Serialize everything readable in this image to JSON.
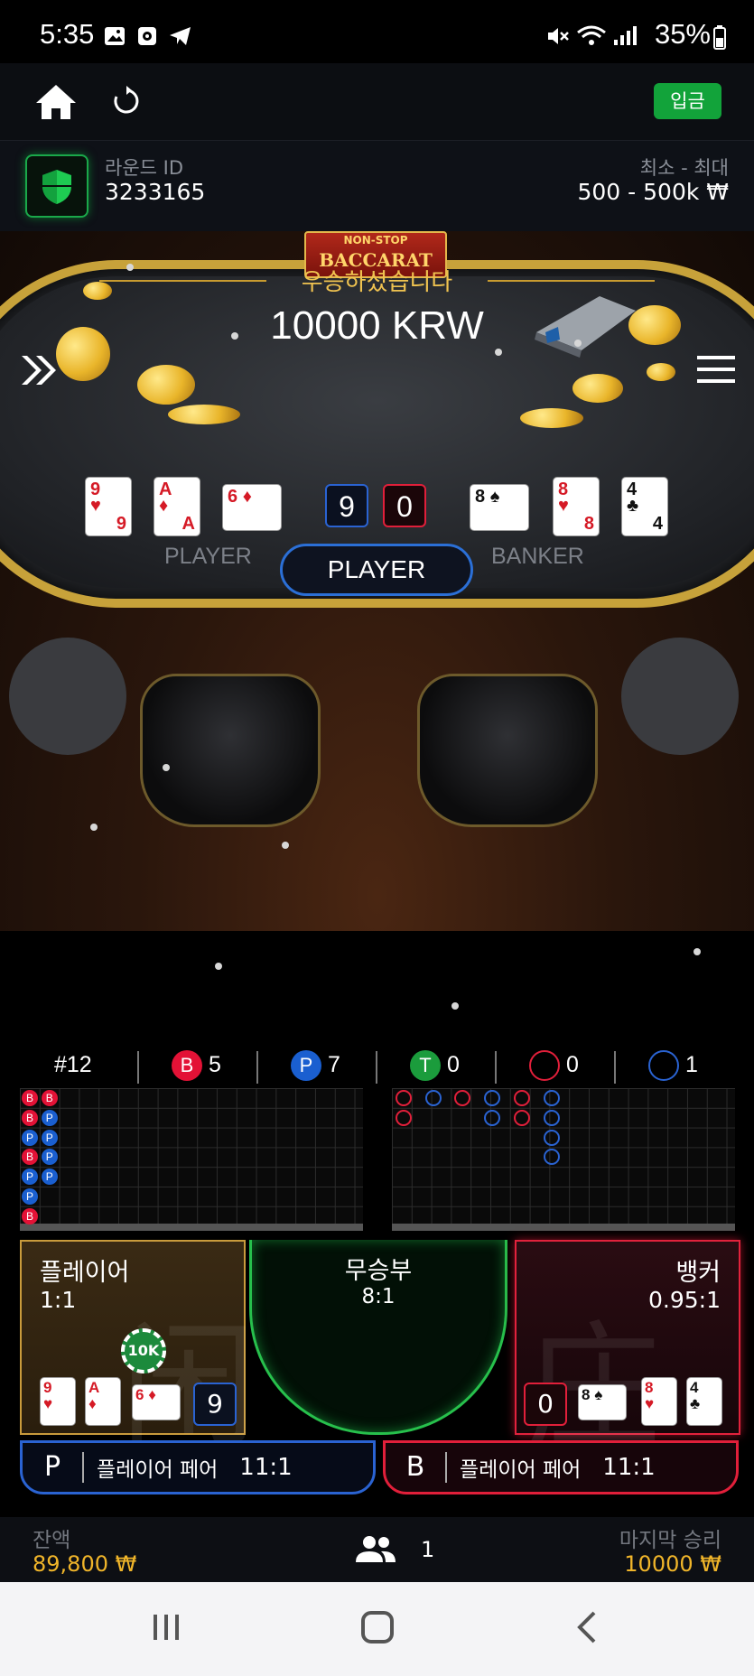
{
  "status_bar": {
    "time": "5:35",
    "battery": "35%"
  },
  "top_nav": {
    "deposit_label": "입금"
  },
  "round": {
    "id_label": "라운드 ID",
    "id_value": "3233165",
    "limit_label": "최소 - 최대",
    "limit_value": "500 - 500k ₩"
  },
  "table": {
    "sign_top": "NON-STOP",
    "sign_main": "BACCARAT",
    "win_message": "우승하셨습니다",
    "win_amount": "10000 KRW",
    "player_label": "PLAYER",
    "banker_label": "BANKER",
    "player_score": "9",
    "banker_score": "0",
    "result": "PLAYER",
    "player_cards": [
      {
        "rank": "9",
        "suit": "♥",
        "color": "red"
      },
      {
        "rank": "A",
        "suit": "♦",
        "color": "red"
      },
      {
        "rank": "6",
        "suit": "♦",
        "color": "red"
      }
    ],
    "banker_cards": [
      {
        "rank": "8",
        "suit": "♠",
        "color": "black"
      },
      {
        "rank": "8",
        "suit": "♥",
        "color": "red"
      },
      {
        "rank": "4",
        "suit": "♣",
        "color": "black"
      }
    ]
  },
  "stats": {
    "round_no": "#12",
    "banker_letter": "B",
    "banker_count": "5",
    "player_letter": "P",
    "player_count": "7",
    "tie_letter": "T",
    "tie_count": "0",
    "banker_pair_count": "0",
    "player_pair_count": "1"
  },
  "bead_road": [
    [
      "B",
      "B",
      "P",
      "B",
      "P",
      "P",
      "B"
    ],
    [
      "B",
      "P",
      "P",
      "P",
      "P"
    ]
  ],
  "big_road": [
    {
      "col": 0,
      "rows": [
        "B",
        "B"
      ]
    },
    {
      "col": 1,
      "rows": [
        "P"
      ]
    },
    {
      "col": 2,
      "rows": [
        "B"
      ]
    },
    {
      "col": 3,
      "rows": [
        "P",
        "P"
      ]
    },
    {
      "col": 4,
      "rows": [
        "B",
        "B"
      ]
    },
    {
      "col": 5,
      "rows": [
        "P",
        "P",
        "P",
        "P"
      ]
    }
  ],
  "bets": {
    "player": {
      "name": "플레이어",
      "odds": "1:1",
      "chip": "10K",
      "score": "9",
      "watermark": "闲"
    },
    "tie": {
      "name": "무승부",
      "odds": "8:1"
    },
    "banker": {
      "name": "뱅커",
      "odds": "0.95:1",
      "score": "0",
      "watermark": "庄"
    },
    "player_pair": {
      "letter": "P",
      "name": "플레이어 페어",
      "odds": "11:1"
    },
    "banker_pair": {
      "letter": "B",
      "name": "플레이어 페어",
      "odds": "11:1"
    }
  },
  "bottom": {
    "balance_label": "잔액",
    "balance_value": "89,800 ₩",
    "players_count": "1",
    "last_win_label": "마지막 승리",
    "last_win_value": "10000 ₩"
  },
  "colors": {
    "gold": "#f0b52a",
    "player_blue": "#2a63d2",
    "banker_red": "#e11f3a",
    "tie_green": "#27c04c",
    "deposit_green": "#12a33a"
  }
}
